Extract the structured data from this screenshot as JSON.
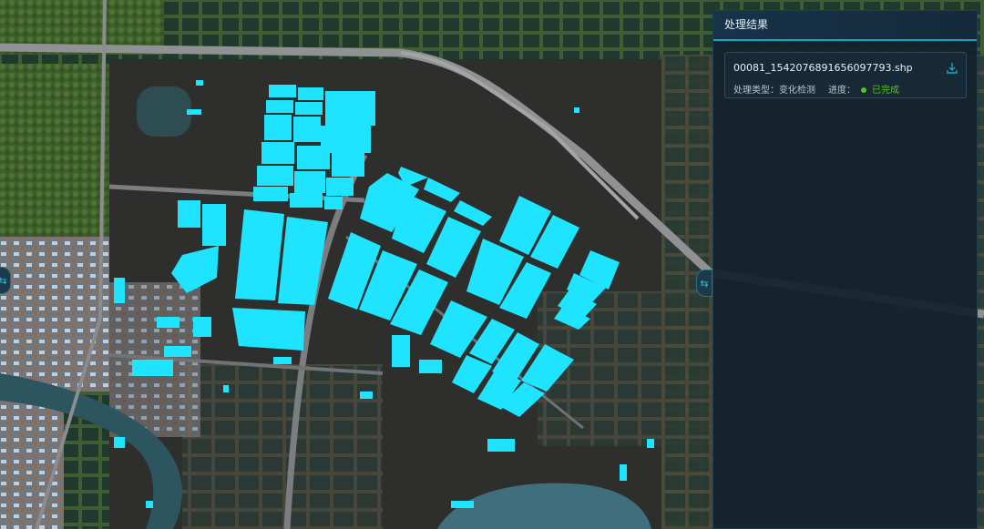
{
  "panel": {
    "title": "处理结果",
    "results": [
      {
        "file_name": "00081_1542076891656097793.shp",
        "type_label": "处理类型：",
        "type_value": "变化检测",
        "progress_label": "进度：",
        "status": "已完成",
        "status_color": "#52c41a",
        "download_icon": "download-icon"
      }
    ]
  },
  "colors": {
    "accent": "#1aa3c8",
    "highlight": "#1ee4ff",
    "panel_bg": "#12212c"
  },
  "controls": {
    "left_toggle_icon": "collapse-icon",
    "right_toggle_icon": "collapse-icon"
  }
}
